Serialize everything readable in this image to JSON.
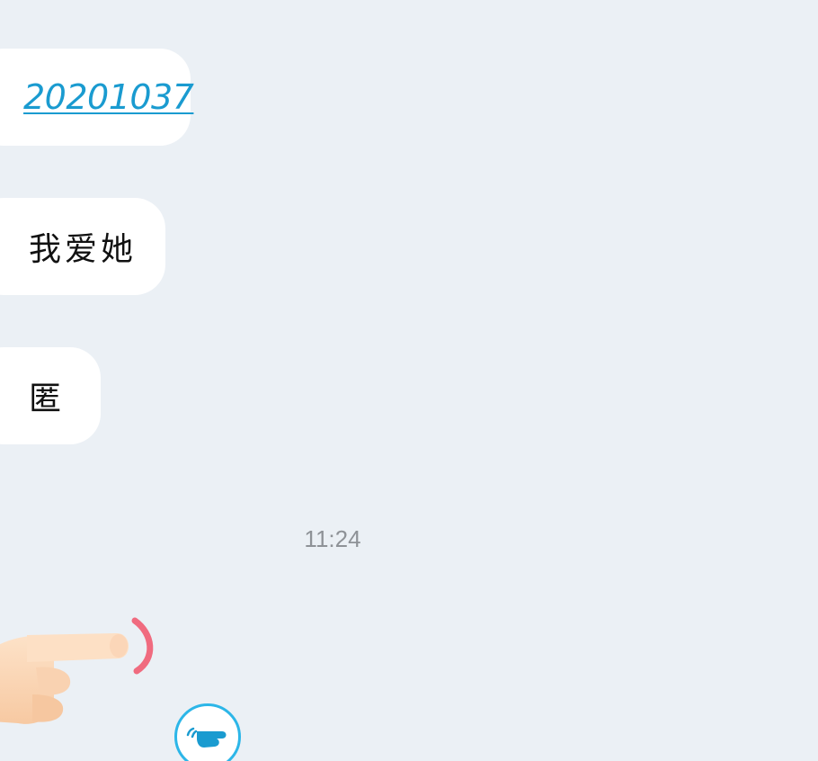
{
  "messages": [
    {
      "text": "20201037",
      "type": "link"
    },
    {
      "text": "我爱她",
      "type": "text"
    },
    {
      "text": "匿",
      "type": "text"
    }
  ],
  "timestamp": "11:24",
  "icons": {
    "poke_hand": "pointing-hand-icon",
    "poke_button": "poke-hand-icon"
  },
  "colors": {
    "background": "#ebf0f5",
    "bubble": "#ffffff",
    "link": "#1a9bd0",
    "timestamp": "#8e9297",
    "poke_accent": "#f06b7f",
    "poke_button_border": "#2cb6e8"
  }
}
